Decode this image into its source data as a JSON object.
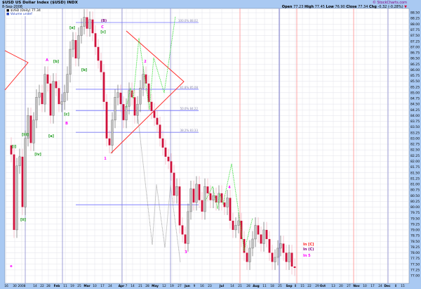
{
  "header": {
    "symbol_title": "$USD US Dollar Index ($USD) INDX",
    "date": "8-Sep-2008",
    "copyright": "© StockCharts.com",
    "open_label": "Open",
    "open": "77.23",
    "high_label": "High",
    "high": "77.45",
    "low_label": "Low",
    "low": "76.90",
    "close_label": "Close",
    "close": "77.34",
    "chg_label": "Chg",
    "chg": "-0.32 (-0.28%)"
  },
  "legend": [
    "$USD (Daily) 77.34",
    "Volume undef"
  ],
  "colors": {
    "up": "#c0c0c0",
    "down": "#d0103a",
    "fib": "#7070ff",
    "trend": "#ff2020",
    "wave_green": "#1a9a1a",
    "wave_magenta": "#ff00ff",
    "projection_green": "#40e040",
    "projection_gray": "#909090",
    "background": "#a9c9f2"
  },
  "chart_data": {
    "type": "candlestick",
    "ylim": [
      77.0,
      88.5
    ],
    "yticks": [
      "88.50",
      "88.25",
      "88.00",
      "87.75",
      "87.50",
      "87.25",
      "87.00",
      "86.75",
      "86.50",
      "86.25",
      "86.00",
      "85.75",
      "85.50",
      "85.25",
      "85.00",
      "84.75",
      "84.50",
      "84.25",
      "84.00",
      "83.75",
      "83.50",
      "83.25",
      "83.00",
      "82.75",
      "82.50",
      "82.25",
      "82.00",
      "81.75",
      "81.50",
      "81.25",
      "81.00",
      "80.75",
      "80.50",
      "80.25",
      "80.00",
      "79.75",
      "79.50",
      "79.25",
      "79.00",
      "78.75",
      "78.50",
      "78.25",
      "78.00",
      "77.75",
      "77.50",
      "77.25",
      "77.00"
    ],
    "xticks": [
      "16",
      "30",
      "2008",
      "14",
      "22",
      "28",
      "Feb",
      "11",
      "19",
      "25",
      "Mar",
      "10",
      "17",
      "24",
      "Apr",
      "7",
      "14",
      "21",
      "28",
      "May",
      "12",
      "19",
      "27",
      "Jun",
      "9",
      "16",
      "23",
      "Jul",
      "14",
      "21",
      "28",
      "Aug",
      "11",
      "18",
      "25",
      "Sep",
      "8",
      "15",
      "22",
      "29",
      "Oct",
      "13",
      "20",
      "27",
      "Nov",
      "10",
      "17",
      "24",
      "Dec",
      "8",
      "15"
    ],
    "grid": true,
    "close": [
      82.3,
      79.0,
      81.8,
      82.2,
      80.0,
      83.0,
      84.0,
      82.8,
      83.8,
      84.8,
      85.0,
      84.5,
      85.8,
      85.4,
      84.0,
      85.5,
      85.2,
      84.5,
      84.6,
      85.0,
      85.8,
      86.9,
      87.3,
      86.5,
      87.5,
      87.9,
      88.3,
      87.8,
      88.2,
      87.6,
      87.0,
      86.4,
      85.9,
      84.6,
      83.0,
      82.7,
      83.8,
      84.8,
      85.0,
      84.5,
      83.8,
      84.4,
      85.1,
      84.8,
      84.0,
      84.5,
      85.2,
      85.8,
      85.4,
      84.6,
      84.2,
      83.9,
      83.6,
      83.0,
      82.6,
      82.2,
      82.0,
      81.5,
      80.5,
      80.9,
      79.2,
      78.8,
      78.4,
      79.8,
      80.8,
      80.2,
      81.0,
      80.3,
      79.8,
      80.9,
      80.6,
      80.3,
      80.5,
      80.2,
      80.6,
      80.2,
      80.0,
      80.4,
      79.4,
      79.0,
      79.2,
      79.4,
      78.6,
      78.0,
      77.6,
      78.2,
      78.6,
      79.2,
      78.8,
      78.4,
      79.0,
      78.6,
      78.0,
      77.6,
      77.8,
      78.2,
      78.4,
      78.0,
      77.6,
      78.0,
      77.4,
      77.34
    ],
    "fib_levels": [
      {
        "label": "100.0% 88.02",
        "price": 88.07
      },
      {
        "label": "61.8% 85.08",
        "price": 85.15
      },
      {
        "label": "50.0% 84.22",
        "price": 84.22
      },
      {
        "label": "38.2% 83.33",
        "price": 83.27
      },
      {
        "label": "",
        "price": 80.1
      }
    ],
    "wave_labels": [
      {
        "text": "[i]",
        "color": "wave_green"
      },
      {
        "text": "[ii]",
        "color": "wave_green"
      },
      {
        "text": "[iii]",
        "color": "wave_green"
      },
      {
        "text": "[iv]",
        "color": "wave_green"
      },
      {
        "text": "A",
        "color": "wave_magenta"
      },
      {
        "text": "[a]",
        "color": "wave_green"
      },
      {
        "text": "[b]",
        "color": "wave_green"
      },
      {
        "text": "[c]",
        "color": "wave_green"
      },
      {
        "text": "B",
        "color": "wave_magenta"
      },
      {
        "text": "[a]",
        "color": "wave_green"
      },
      {
        "text": "[b]",
        "color": "wave_green"
      },
      {
        "text": "(B)",
        "color": "#800080"
      },
      {
        "text": "C",
        "color": "wave_magenta"
      },
      {
        "text": "[c]",
        "color": "wave_green"
      },
      {
        "text": "1",
        "color": "wave_magenta"
      },
      {
        "text": "2",
        "color": "wave_magenta"
      },
      {
        "text": "3",
        "color": "wave_magenta"
      },
      {
        "text": "4",
        "color": "wave_magenta"
      },
      {
        "text": "e",
        "color": "wave_magenta"
      },
      {
        "text": "In [C]",
        "color": "#ff2020"
      },
      {
        "text": "In (C)",
        "color": "#800080"
      },
      {
        "text": "In 5",
        "color": "wave_magenta"
      }
    ]
  }
}
